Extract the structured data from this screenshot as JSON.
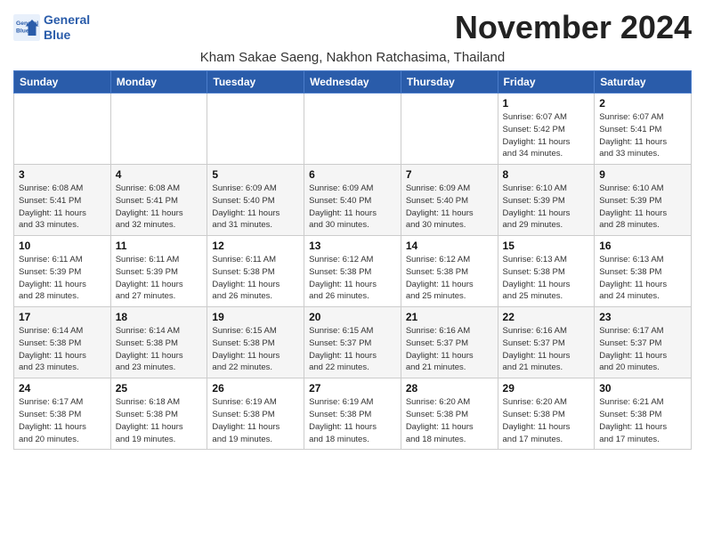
{
  "header": {
    "logo_line1": "General",
    "logo_line2": "Blue",
    "title": "November 2024",
    "subtitle": "Kham Sakae Saeng, Nakhon Ratchasima, Thailand"
  },
  "weekdays": [
    "Sunday",
    "Monday",
    "Tuesday",
    "Wednesday",
    "Thursday",
    "Friday",
    "Saturday"
  ],
  "weeks": [
    [
      {
        "day": "",
        "info": ""
      },
      {
        "day": "",
        "info": ""
      },
      {
        "day": "",
        "info": ""
      },
      {
        "day": "",
        "info": ""
      },
      {
        "day": "",
        "info": ""
      },
      {
        "day": "1",
        "info": "Sunrise: 6:07 AM\nSunset: 5:42 PM\nDaylight: 11 hours\nand 34 minutes."
      },
      {
        "day": "2",
        "info": "Sunrise: 6:07 AM\nSunset: 5:41 PM\nDaylight: 11 hours\nand 33 minutes."
      }
    ],
    [
      {
        "day": "3",
        "info": "Sunrise: 6:08 AM\nSunset: 5:41 PM\nDaylight: 11 hours\nand 33 minutes."
      },
      {
        "day": "4",
        "info": "Sunrise: 6:08 AM\nSunset: 5:41 PM\nDaylight: 11 hours\nand 32 minutes."
      },
      {
        "day": "5",
        "info": "Sunrise: 6:09 AM\nSunset: 5:40 PM\nDaylight: 11 hours\nand 31 minutes."
      },
      {
        "day": "6",
        "info": "Sunrise: 6:09 AM\nSunset: 5:40 PM\nDaylight: 11 hours\nand 30 minutes."
      },
      {
        "day": "7",
        "info": "Sunrise: 6:09 AM\nSunset: 5:40 PM\nDaylight: 11 hours\nand 30 minutes."
      },
      {
        "day": "8",
        "info": "Sunrise: 6:10 AM\nSunset: 5:39 PM\nDaylight: 11 hours\nand 29 minutes."
      },
      {
        "day": "9",
        "info": "Sunrise: 6:10 AM\nSunset: 5:39 PM\nDaylight: 11 hours\nand 28 minutes."
      }
    ],
    [
      {
        "day": "10",
        "info": "Sunrise: 6:11 AM\nSunset: 5:39 PM\nDaylight: 11 hours\nand 28 minutes."
      },
      {
        "day": "11",
        "info": "Sunrise: 6:11 AM\nSunset: 5:39 PM\nDaylight: 11 hours\nand 27 minutes."
      },
      {
        "day": "12",
        "info": "Sunrise: 6:11 AM\nSunset: 5:38 PM\nDaylight: 11 hours\nand 26 minutes."
      },
      {
        "day": "13",
        "info": "Sunrise: 6:12 AM\nSunset: 5:38 PM\nDaylight: 11 hours\nand 26 minutes."
      },
      {
        "day": "14",
        "info": "Sunrise: 6:12 AM\nSunset: 5:38 PM\nDaylight: 11 hours\nand 25 minutes."
      },
      {
        "day": "15",
        "info": "Sunrise: 6:13 AM\nSunset: 5:38 PM\nDaylight: 11 hours\nand 25 minutes."
      },
      {
        "day": "16",
        "info": "Sunrise: 6:13 AM\nSunset: 5:38 PM\nDaylight: 11 hours\nand 24 minutes."
      }
    ],
    [
      {
        "day": "17",
        "info": "Sunrise: 6:14 AM\nSunset: 5:38 PM\nDaylight: 11 hours\nand 23 minutes."
      },
      {
        "day": "18",
        "info": "Sunrise: 6:14 AM\nSunset: 5:38 PM\nDaylight: 11 hours\nand 23 minutes."
      },
      {
        "day": "19",
        "info": "Sunrise: 6:15 AM\nSunset: 5:38 PM\nDaylight: 11 hours\nand 22 minutes."
      },
      {
        "day": "20",
        "info": "Sunrise: 6:15 AM\nSunset: 5:37 PM\nDaylight: 11 hours\nand 22 minutes."
      },
      {
        "day": "21",
        "info": "Sunrise: 6:16 AM\nSunset: 5:37 PM\nDaylight: 11 hours\nand 21 minutes."
      },
      {
        "day": "22",
        "info": "Sunrise: 6:16 AM\nSunset: 5:37 PM\nDaylight: 11 hours\nand 21 minutes."
      },
      {
        "day": "23",
        "info": "Sunrise: 6:17 AM\nSunset: 5:37 PM\nDaylight: 11 hours\nand 20 minutes."
      }
    ],
    [
      {
        "day": "24",
        "info": "Sunrise: 6:17 AM\nSunset: 5:38 PM\nDaylight: 11 hours\nand 20 minutes."
      },
      {
        "day": "25",
        "info": "Sunrise: 6:18 AM\nSunset: 5:38 PM\nDaylight: 11 hours\nand 19 minutes."
      },
      {
        "day": "26",
        "info": "Sunrise: 6:19 AM\nSunset: 5:38 PM\nDaylight: 11 hours\nand 19 minutes."
      },
      {
        "day": "27",
        "info": "Sunrise: 6:19 AM\nSunset: 5:38 PM\nDaylight: 11 hours\nand 18 minutes."
      },
      {
        "day": "28",
        "info": "Sunrise: 6:20 AM\nSunset: 5:38 PM\nDaylight: 11 hours\nand 18 minutes."
      },
      {
        "day": "29",
        "info": "Sunrise: 6:20 AM\nSunset: 5:38 PM\nDaylight: 11 hours\nand 17 minutes."
      },
      {
        "day": "30",
        "info": "Sunrise: 6:21 AM\nSunset: 5:38 PM\nDaylight: 11 hours\nand 17 minutes."
      }
    ]
  ]
}
